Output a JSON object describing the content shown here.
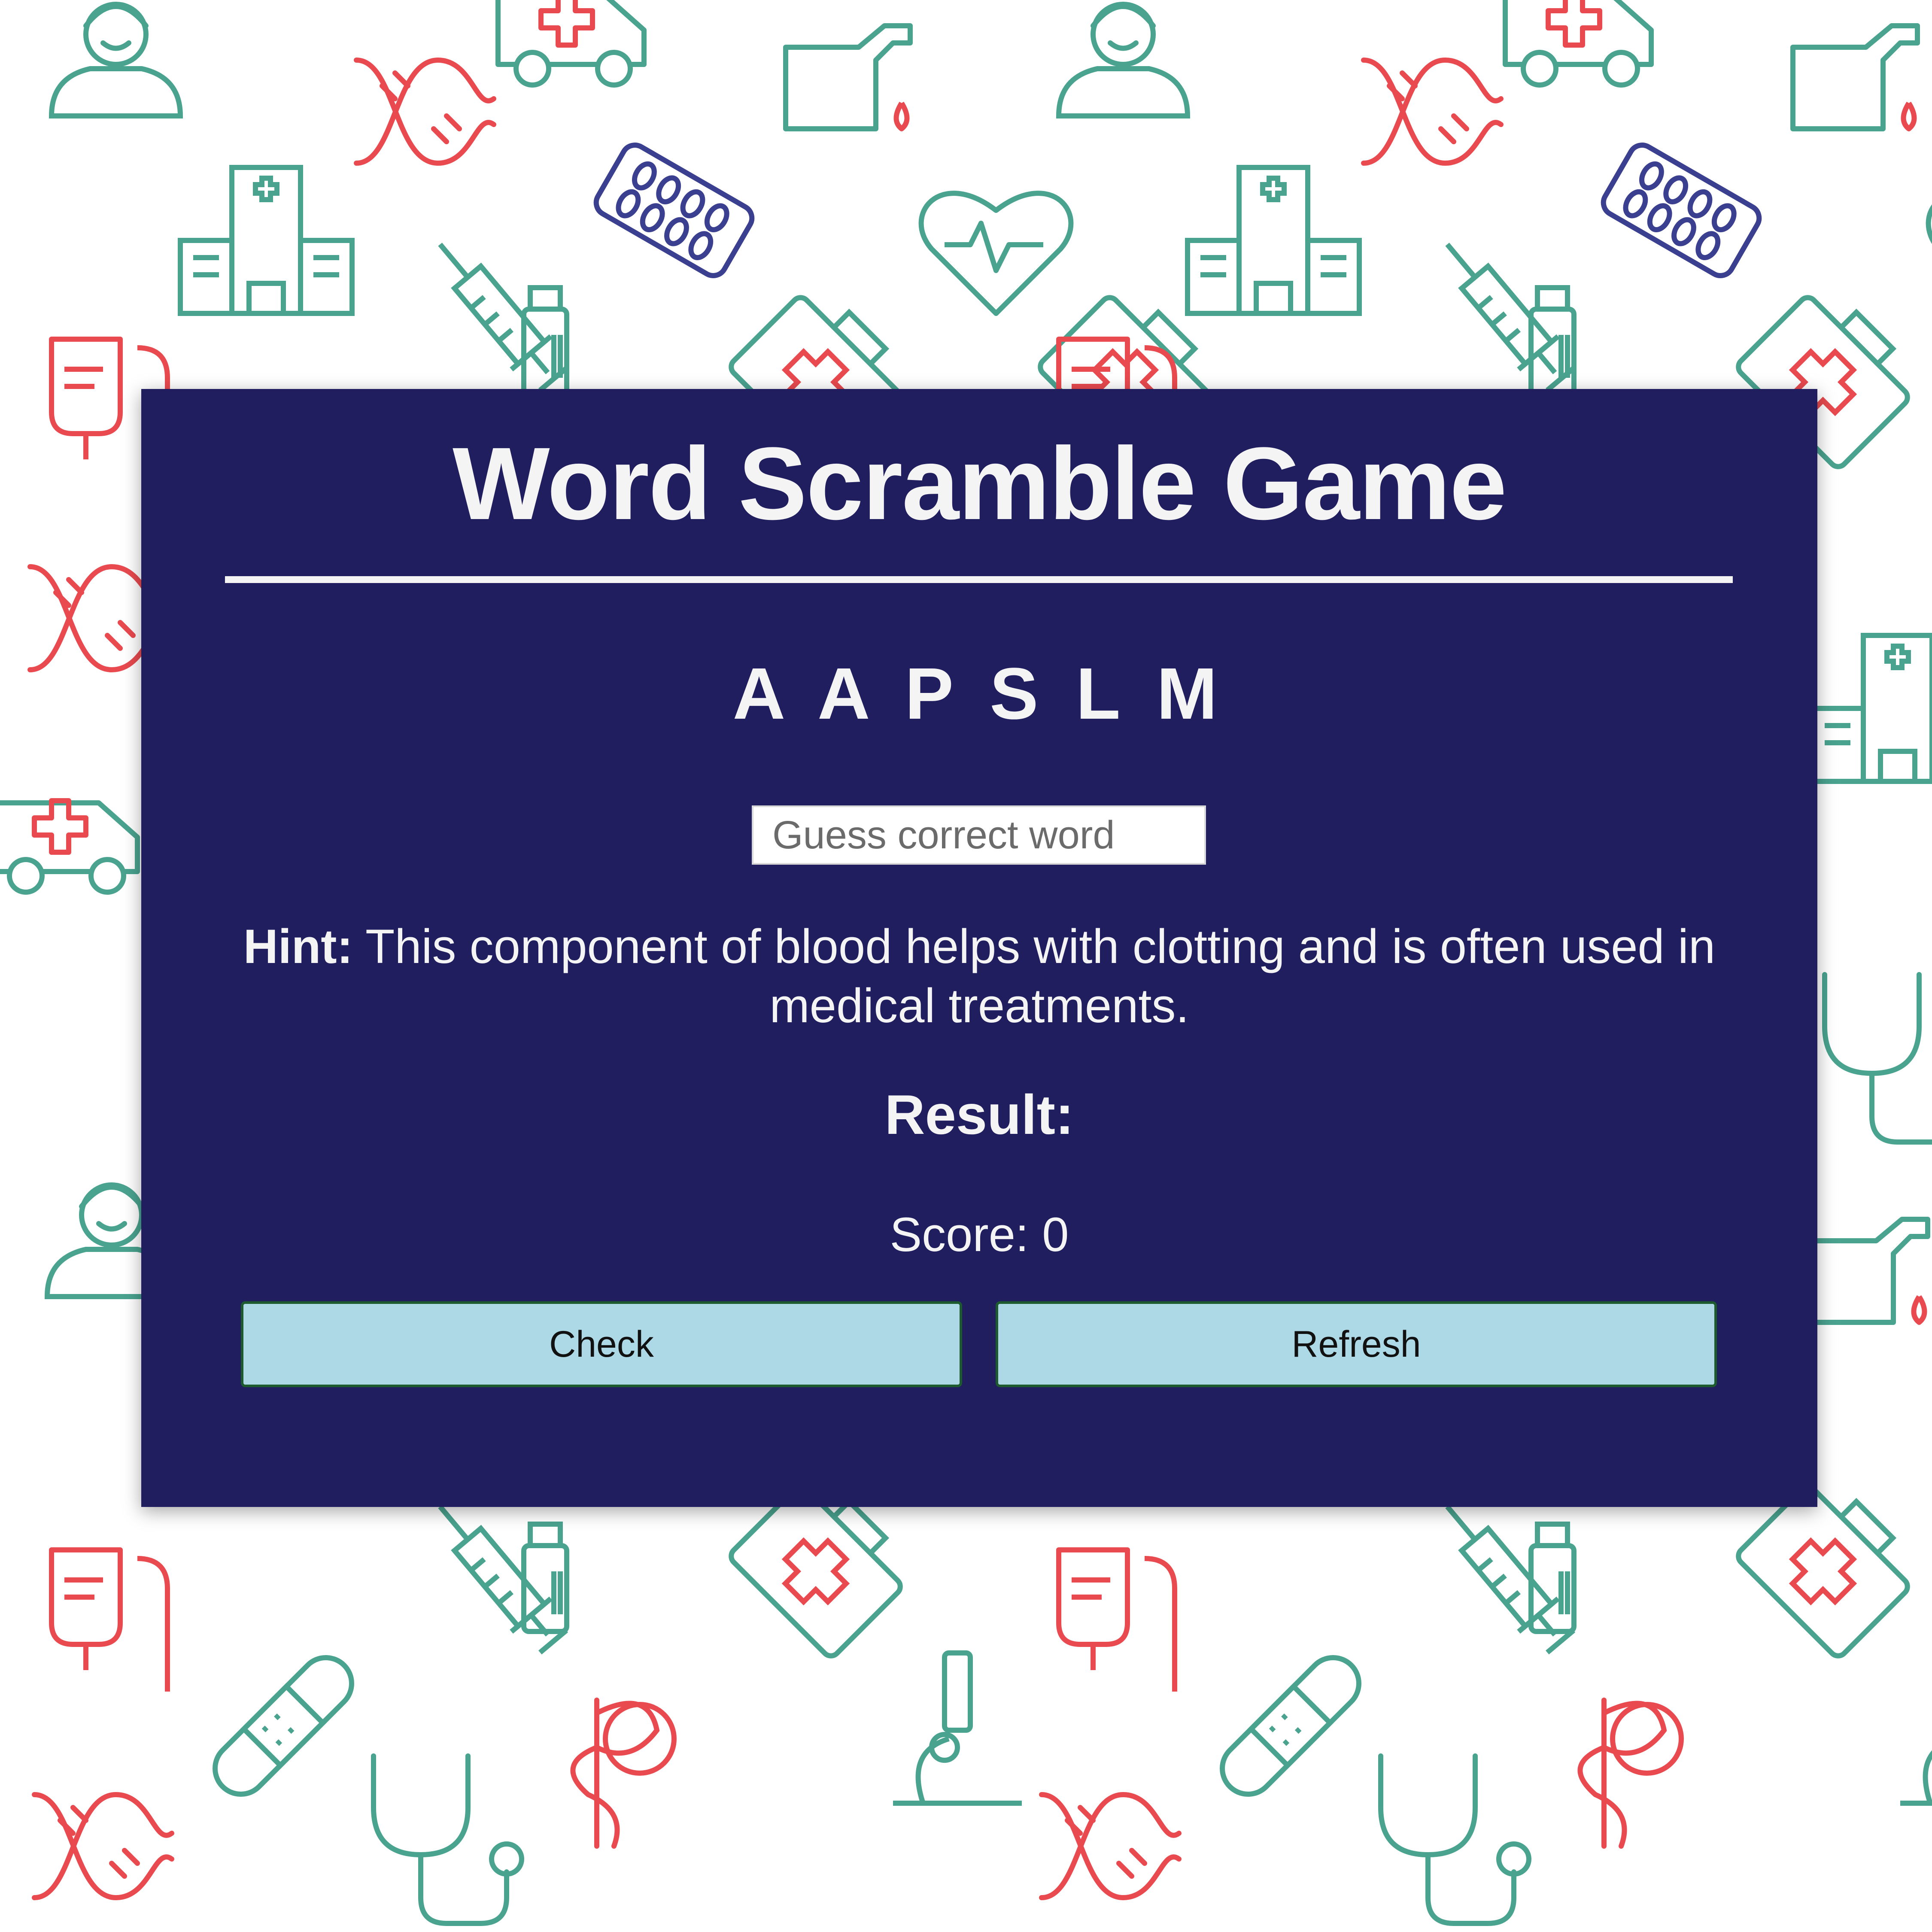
{
  "colors": {
    "panel": "#211e5f",
    "text": "#f4f4f4",
    "button": "#add8e6",
    "pattern_green": "#4aa38f",
    "pattern_red": "#e84a4f",
    "pattern_navy": "#3a3f8f"
  },
  "background": {
    "pattern_icons": [
      "nurse-icon",
      "ambulance-icon",
      "blood-test-icon",
      "dna-icon",
      "hospital-icon",
      "pill-pack-icon",
      "heartbeat-icon",
      "syringe-icon",
      "medicine-bottle-icon",
      "first-aid-kit-icon",
      "iv-bag-icon",
      "bandage-icon",
      "microscope-icon",
      "stethoscope-icon",
      "caduceus-icon"
    ]
  },
  "game": {
    "title": "Word Scramble Game",
    "scrambled_word": "AAPSLM",
    "guess_input": {
      "placeholder": "Guess correct word",
      "value": ""
    },
    "hint": {
      "label": "Hint:",
      "text": "This component of blood helps with clotting and is often used in medical treatments."
    },
    "result_label": "Result:",
    "score_text": "Score: 0",
    "buttons": {
      "check": "Check",
      "refresh": "Refresh"
    }
  }
}
